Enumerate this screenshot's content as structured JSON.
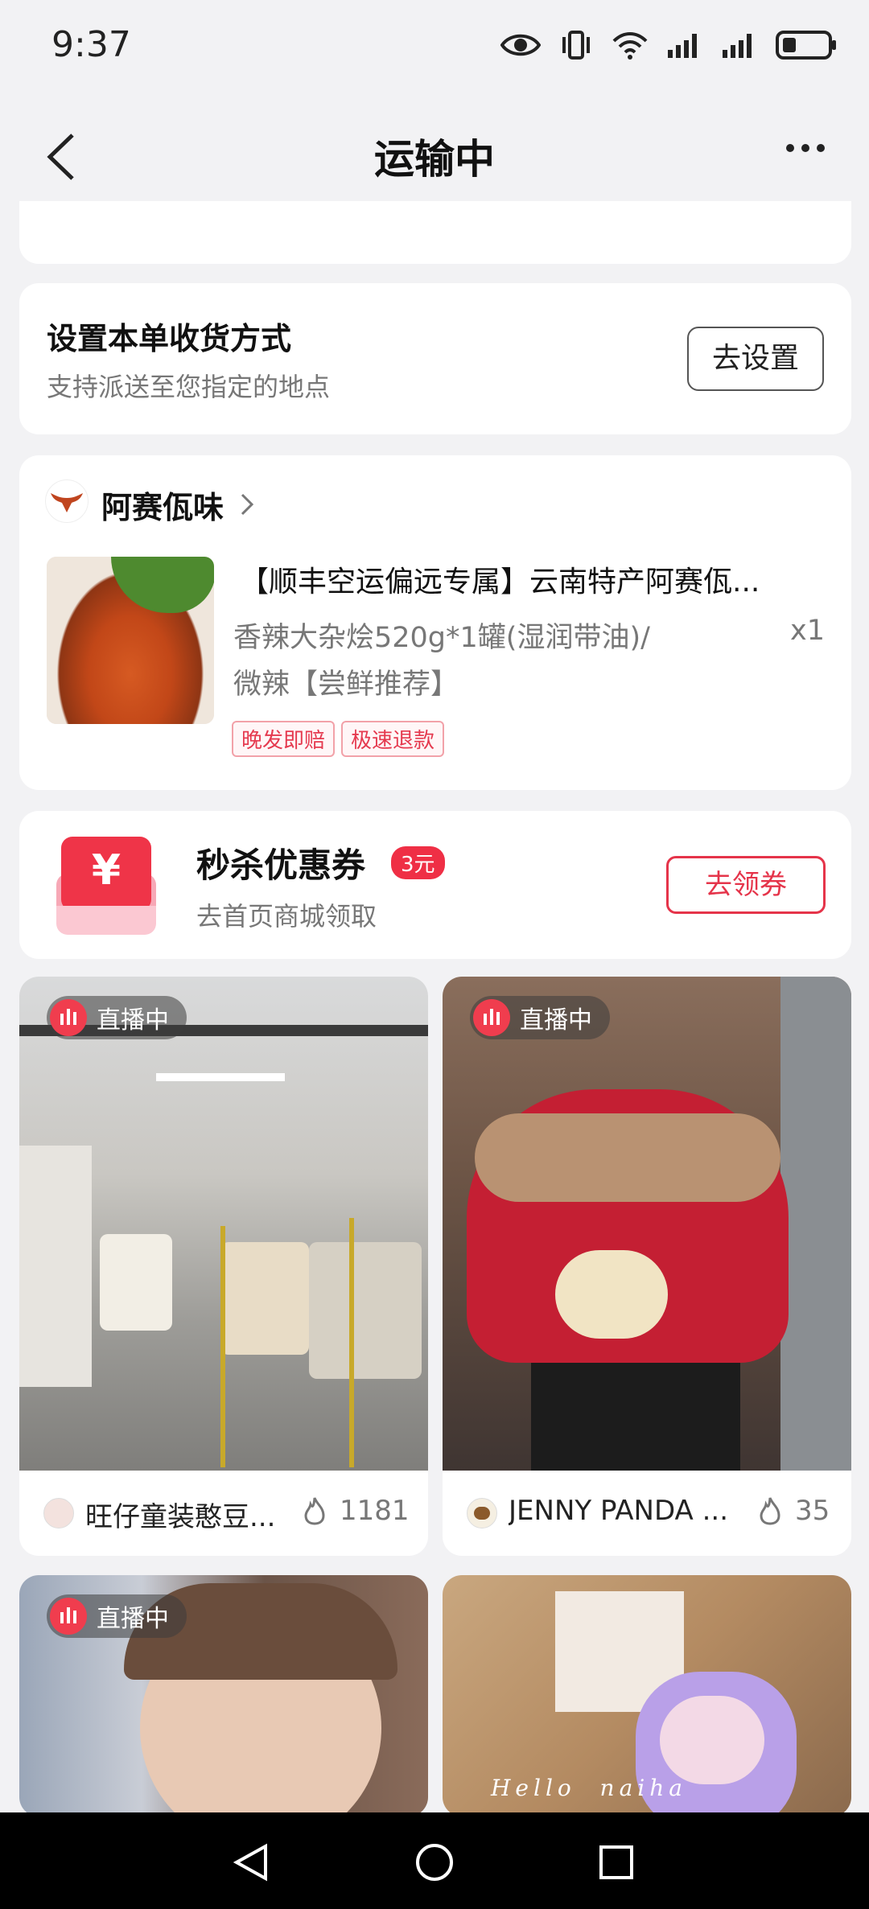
{
  "status_bar": {
    "time": "9:37"
  },
  "header": {
    "title": "运输中"
  },
  "delivery": {
    "title": "设置本单收货方式",
    "subtitle": "支持派送至您指定的地点",
    "button": "去设置"
  },
  "order": {
    "shop_name": "阿赛佤味",
    "product_title": "【顺丰空运偏远专属】云南特产阿赛佤...",
    "spec_line1": "香辣大杂烩520g*1罐(湿润带油)/",
    "spec_line2": "微辣【尝鲜推荐】",
    "quantity": "x1",
    "tags": [
      "晚发即赔",
      "极速退款"
    ]
  },
  "coupon": {
    "icon_symbol": "¥",
    "title": "秒杀优惠券",
    "badge": "3元",
    "subtitle": "去首页商城领取",
    "button": "去领券"
  },
  "feed": [
    {
      "live_label": "直播中",
      "name": "旺仔童装憨豆...",
      "count": "1181"
    },
    {
      "live_label": "直播中",
      "name": "JENNY PANDA ...",
      "count": "35"
    },
    {
      "live_label": "直播中"
    },
    {
      "overlay_text": "Hello  naiha"
    }
  ],
  "colors": {
    "accent": "#e5344a",
    "background": "#f2f2f4"
  }
}
